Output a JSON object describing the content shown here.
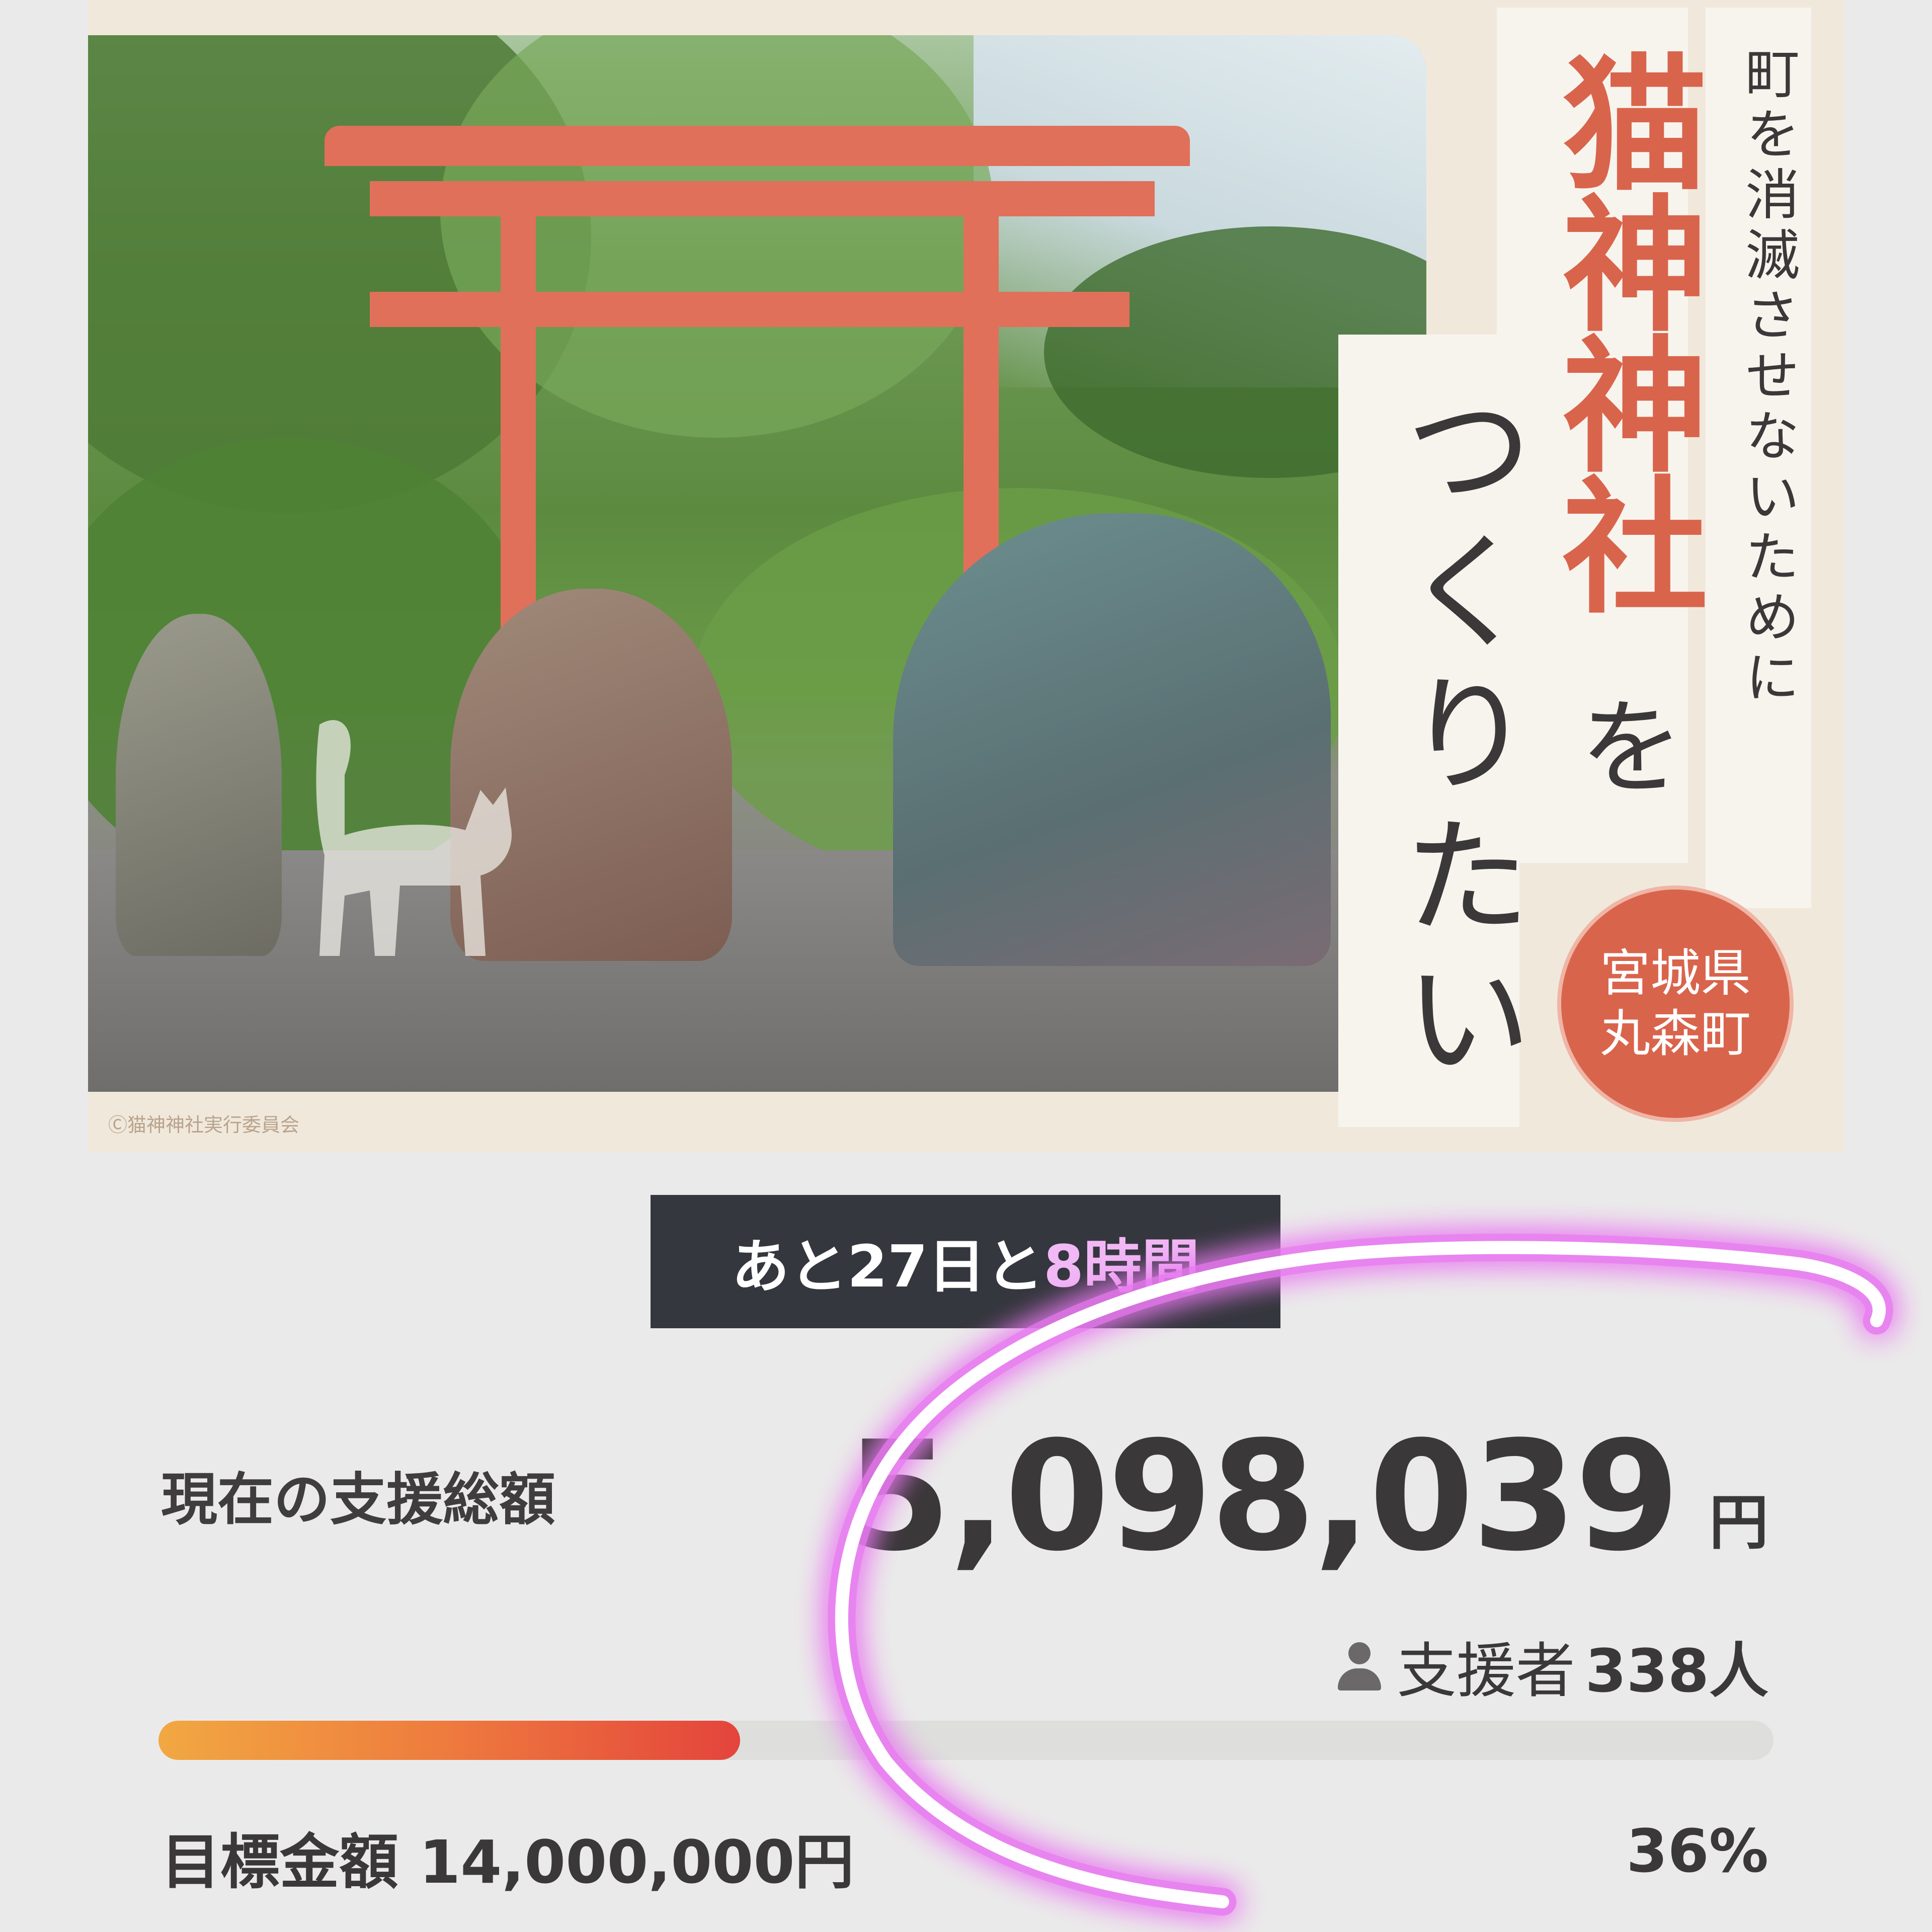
{
  "hero": {
    "subtitle": "町を消滅させないために",
    "title_main": "猫神神社",
    "title_particle": "を",
    "title_tail": "つくりたい",
    "badge_line1": "宮城県",
    "badge_line2": "丸森町",
    "credit": "Ⓒ猫神神社実行委員会"
  },
  "countdown": {
    "prefix": "あと27日と",
    "highlight": "8時間"
  },
  "funding": {
    "current_label": "現在の支援総額",
    "amount": "5,098,039",
    "currency": "円",
    "backers_label": "支援者",
    "backers_count": "338人",
    "progress_percent": 36,
    "goal_label": "目標金額",
    "goal_amount": "14,000,000円",
    "percent_text": "36%"
  },
  "icons": {
    "backers": "person-icon"
  },
  "colors": {
    "accent": "#d9644c",
    "progress_start": "#f1a842",
    "progress_end": "#e4443c",
    "countdown_bg": "#34373d",
    "scribble": "#e879f0"
  }
}
